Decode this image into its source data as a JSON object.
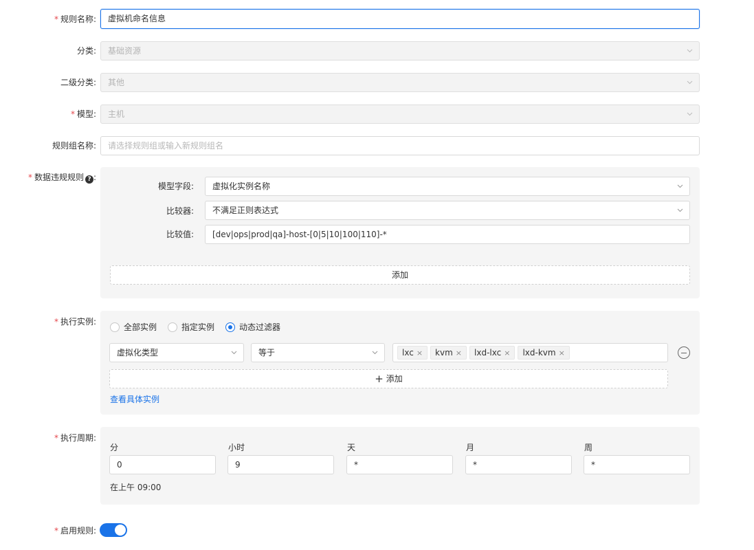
{
  "form": {
    "rule_name": {
      "label": "规则名称",
      "value": "虚拟机命名信息"
    },
    "category": {
      "label": "分类",
      "value": "基础资源"
    },
    "sub_category": {
      "label": "二级分类",
      "value": "其他"
    },
    "model": {
      "label": "模型",
      "value": "主机"
    },
    "rule_group": {
      "label": "规则组名称",
      "placeholder": "请选择规则组或输入新规则组名"
    },
    "violation": {
      "label": "数据违规规则",
      "field_label": "模型字段:",
      "field_value": "虚拟化实例名称",
      "comparator_label": "比较器:",
      "comparator_value": "不满足正则表达式",
      "compare_value_label": "比较值:",
      "compare_value": "[dev|ops|prod|qa]-host-[0|5|10|100|110]-*",
      "add_label": "添加"
    },
    "execution": {
      "label": "执行实例",
      "radios": [
        "全部实例",
        "指定实例",
        "动态过滤器"
      ],
      "selected_radio": "动态过滤器",
      "filter_field": "虚拟化类型",
      "filter_operator": "等于",
      "filter_tags": [
        "lxc",
        "kvm",
        "lxd-lxc",
        "lxd-kvm"
      ],
      "tag_remove_glyph": "×",
      "add_label": "添加",
      "add_glyph": "+",
      "view_link": "查看具体实例"
    },
    "schedule": {
      "label": "执行周期",
      "fields": [
        {
          "label": "分",
          "value": "0"
        },
        {
          "label": "小时",
          "value": "9"
        },
        {
          "label": "天",
          "value": "*"
        },
        {
          "label": "月",
          "value": "*"
        },
        {
          "label": "周",
          "value": "*"
        }
      ],
      "summary": "在上午 09:00"
    },
    "enable": {
      "label": "启用规则",
      "on": true
    },
    "required_mark": "*",
    "label_suffix": ":"
  },
  "colors": {
    "accent": "#1a73e8",
    "required": "#e5484d",
    "panel_bg": "#f5f5f5"
  }
}
